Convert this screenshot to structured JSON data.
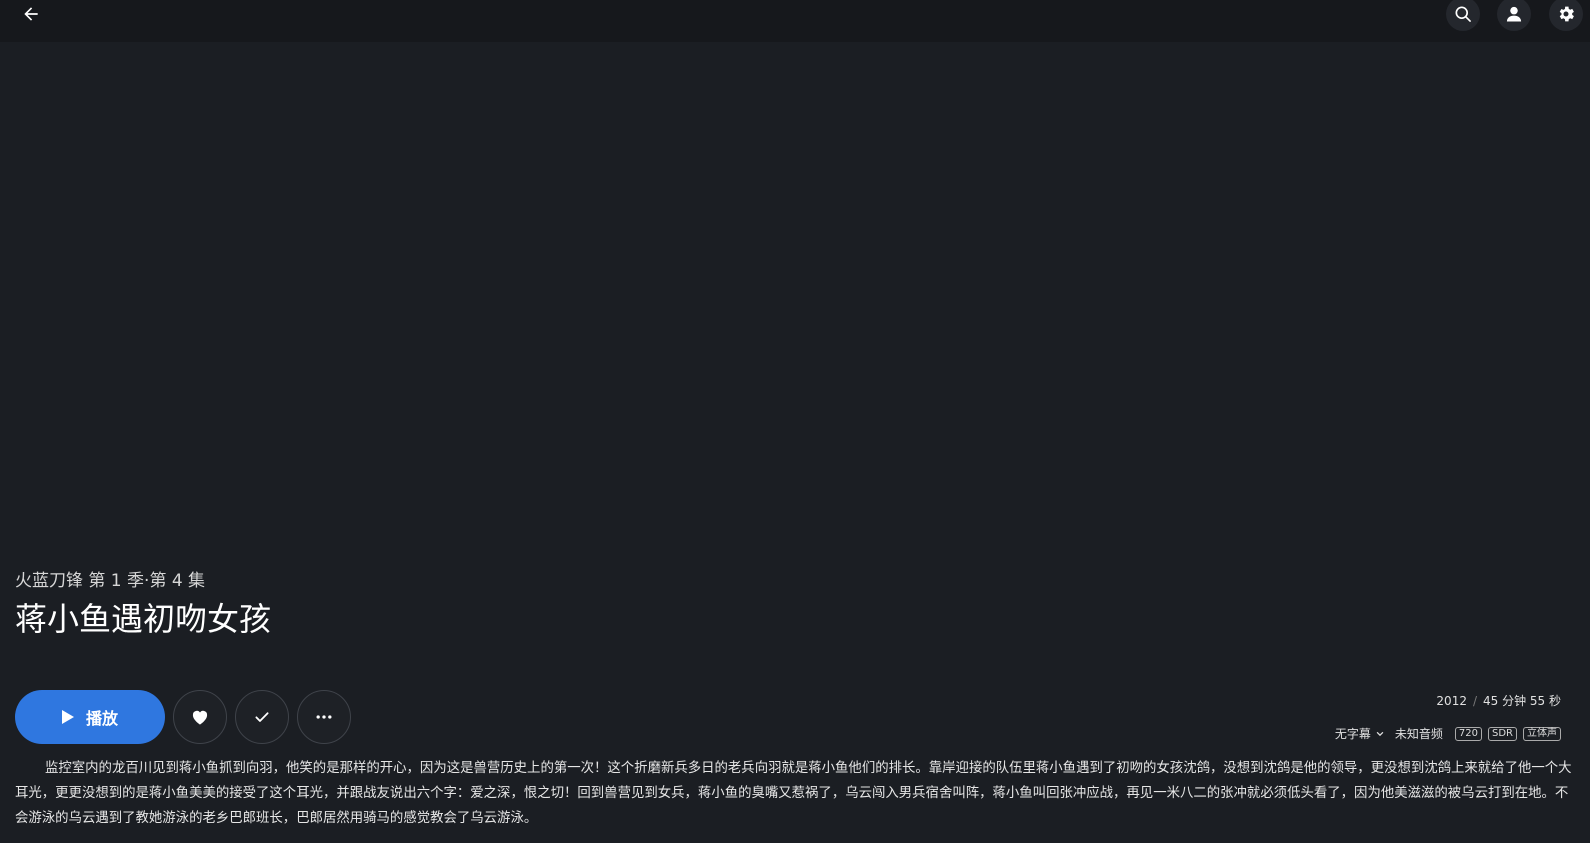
{
  "series": {
    "name": "火蓝刀锋",
    "season_label": "第 1 季",
    "separator": "·",
    "episode_label": "第 4 集"
  },
  "episode": {
    "title": "蒋小鱼遇初吻女孩"
  },
  "actions": {
    "play_label": "播放"
  },
  "meta": {
    "year": "2012",
    "separator": "/",
    "duration": "45 分钟 55 秒"
  },
  "streams": {
    "subtitle": "无字幕",
    "audio": "未知音频",
    "badges": [
      "720",
      "SDR",
      "立体声"
    ]
  },
  "overview": "监控室内的龙百川见到蒋小鱼抓到向羽，他笑的是那样的开心，因为这是兽营历史上的第一次！这个折磨新兵多日的老兵向羽就是蒋小鱼他们的排长。靠岸迎接的队伍里蒋小鱼遇到了初吻的女孩沈鸽，没想到沈鸽是他的领导，更没想到沈鸽上来就给了他一个大耳光，更更没想到的是蒋小鱼美美的接受了这个耳光，并跟战友说出六个字：爱之深，恨之切！回到兽营见到女兵，蒋小鱼的臭嘴又惹祸了，乌云闯入男兵宿舍叫阵，蒋小鱼叫回张冲应战，再见一米八二的张冲就必须低头看了，因为他美滋滋的被乌云打到在地。不会游泳的乌云遇到了教她游泳的老乡巴郎班长，巴郎居然用骑马的感觉教会了乌云游泳。",
  "icons": {
    "back": "arrow-left-icon",
    "search": "search-icon",
    "user": "user-icon",
    "settings": "gear-icon",
    "play": "play-icon",
    "favorite": "heart-icon",
    "watched": "check-icon",
    "more": "more-icon",
    "dropdown": "chevron-down-icon"
  },
  "colors": {
    "background": "#1b1e23",
    "topbar": "#16181c",
    "accent": "#2f77e0"
  }
}
